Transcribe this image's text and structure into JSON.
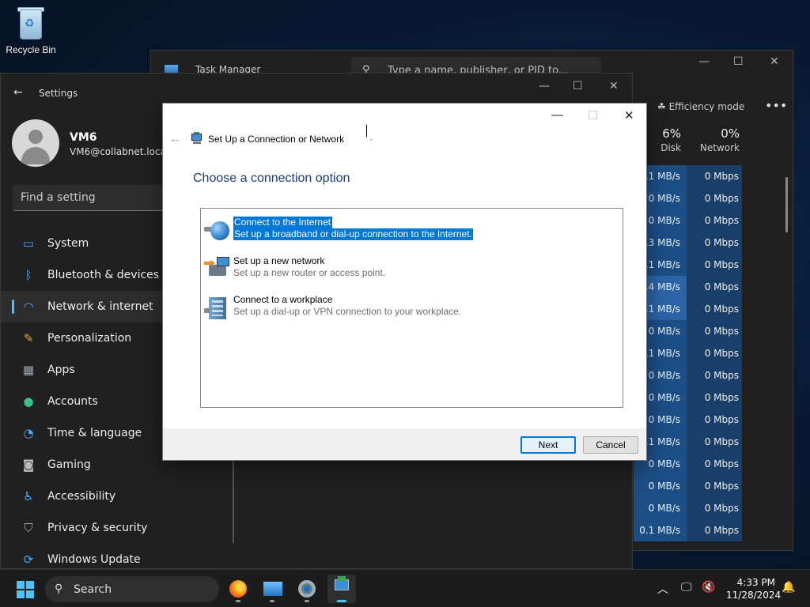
{
  "desktop": {
    "recycle_bin_label": "Recycle Bin"
  },
  "task_manager": {
    "title": "Task Manager",
    "search_placeholder": "Type a name, publisher, or PID to...",
    "efficiency_mode": "Efficiency mode",
    "more": "•••",
    "columns": [
      {
        "pct": "6%",
        "label": "Disk"
      },
      {
        "pct": "0%",
        "label": "Network"
      }
    ],
    "rows": [
      {
        "disk": "0.1 MB/s",
        "net": "0 Mbps"
      },
      {
        "disk": "0 MB/s",
        "net": "0 Mbps"
      },
      {
        "disk": "0 MB/s",
        "net": "0 Mbps"
      },
      {
        "disk": "0.3 MB/s",
        "net": "0 Mbps"
      },
      {
        "disk": "0.1 MB/s",
        "net": "0 Mbps"
      },
      {
        "disk": "0.4 MB/s",
        "net": "0 Mbps"
      },
      {
        "disk": "0.1 MB/s",
        "net": "0 Mbps"
      },
      {
        "disk": "0 MB/s",
        "net": "0 Mbps"
      },
      {
        "disk": "0.1 MB/s",
        "net": "0 Mbps"
      },
      {
        "disk": "0 MB/s",
        "net": "0 Mbps"
      },
      {
        "disk": "0 MB/s",
        "net": "0 Mbps"
      },
      {
        "disk": "0 MB/s",
        "net": "0 Mbps"
      },
      {
        "disk": "0.1 MB/s",
        "net": "0 Mbps"
      },
      {
        "disk": "0 MB/s",
        "net": "0 Mbps"
      },
      {
        "disk": "0 MB/s",
        "net": "0 Mbps"
      },
      {
        "disk": "0 MB/s",
        "net": "0 Mbps"
      },
      {
        "disk": "0.1 MB/s",
        "net": "0 Mbps"
      }
    ]
  },
  "settings": {
    "title": "Settings",
    "user_name": "VM6",
    "user_email": "VM6@collabnet.local",
    "search_placeholder": "Find a setting",
    "nav": [
      {
        "label": "System",
        "icon": "monitor-icon"
      },
      {
        "label": "Bluetooth & devices",
        "icon": "bluetooth-icon"
      },
      {
        "label": "Network & internet",
        "icon": "wifi-icon"
      },
      {
        "label": "Personalization",
        "icon": "brush-icon"
      },
      {
        "label": "Apps",
        "icon": "apps-icon"
      },
      {
        "label": "Accounts",
        "icon": "person-icon"
      },
      {
        "label": "Time & language",
        "icon": "clock-globe-icon"
      },
      {
        "label": "Gaming",
        "icon": "gamepad-icon"
      },
      {
        "label": "Accessibility",
        "icon": "accessibility-icon"
      },
      {
        "label": "Privacy & security",
        "icon": "shield-icon"
      },
      {
        "label": "Windows Update",
        "icon": "update-icon"
      }
    ],
    "active_index": 2
  },
  "dialog": {
    "title": "Set Up a Connection or Network",
    "heading": "Choose a connection option",
    "options": [
      {
        "title": "Connect to the Internet",
        "desc": "Set up a broadband or dial-up connection to the Internet.",
        "icon": "globe-icon"
      },
      {
        "title": "Set up a new network",
        "desc": "Set up a new router or access point.",
        "icon": "router-icon"
      },
      {
        "title": "Connect to a workplace",
        "desc": "Set up a dial-up or VPN connection to your workplace.",
        "icon": "building-icon"
      }
    ],
    "next_label": "Next",
    "cancel_label": "Cancel"
  },
  "taskbar": {
    "search_label": "Search",
    "time": "4:33 PM",
    "date": "11/28/2024"
  },
  "colors": {
    "accent": "#0078d7",
    "heading_blue": "#1e3b73",
    "taskbar_accent": "#4cc2ff"
  }
}
